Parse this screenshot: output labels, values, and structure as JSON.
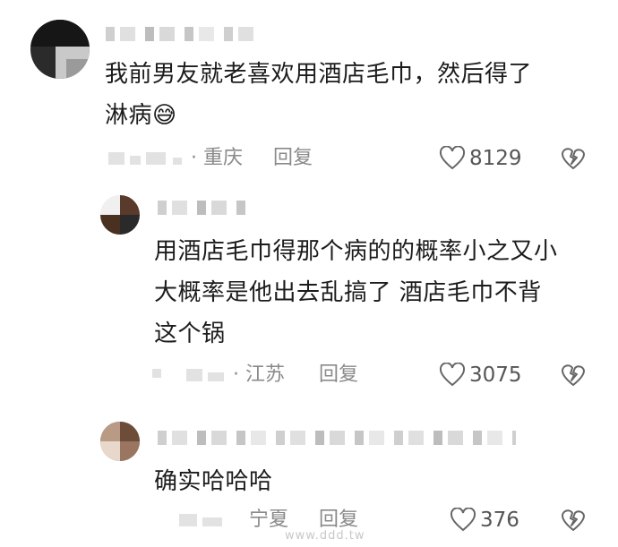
{
  "comments": [
    {
      "text_lines": [
        "我前男友就老喜欢用酒店毛巾，然后得了",
        "淋病😅"
      ],
      "location": "· 重庆",
      "reply_label": "回复",
      "likes": "8129",
      "avatar_icon": "user-avatar-icon",
      "like_icon": "heart-outline-icon",
      "dislike_icon": "broken-heart-icon"
    },
    {
      "text_lines": [
        "用酒店毛巾得那个病的的概率小之又小",
        "大概率是他出去乱搞了  酒店毛巾不背",
        "这个锅"
      ],
      "location": "· 江苏",
      "reply_label": "回复",
      "likes": "3075",
      "avatar_icon": "user-avatar-icon",
      "like_icon": "heart-outline-icon",
      "dislike_icon": "broken-heart-icon"
    },
    {
      "text_lines": [
        "确实哈哈哈"
      ],
      "location": "宁夏",
      "reply_label": "回复",
      "likes": "376",
      "avatar_icon": "user-avatar-icon",
      "like_icon": "heart-outline-icon",
      "dislike_icon": "broken-heart-icon"
    }
  ],
  "watermark": "www.ddd.tw",
  "colors": {
    "text": "#1c1c1c",
    "meta": "#8a8a8a",
    "icon": "#555555",
    "blur": "#d6d6d6"
  }
}
